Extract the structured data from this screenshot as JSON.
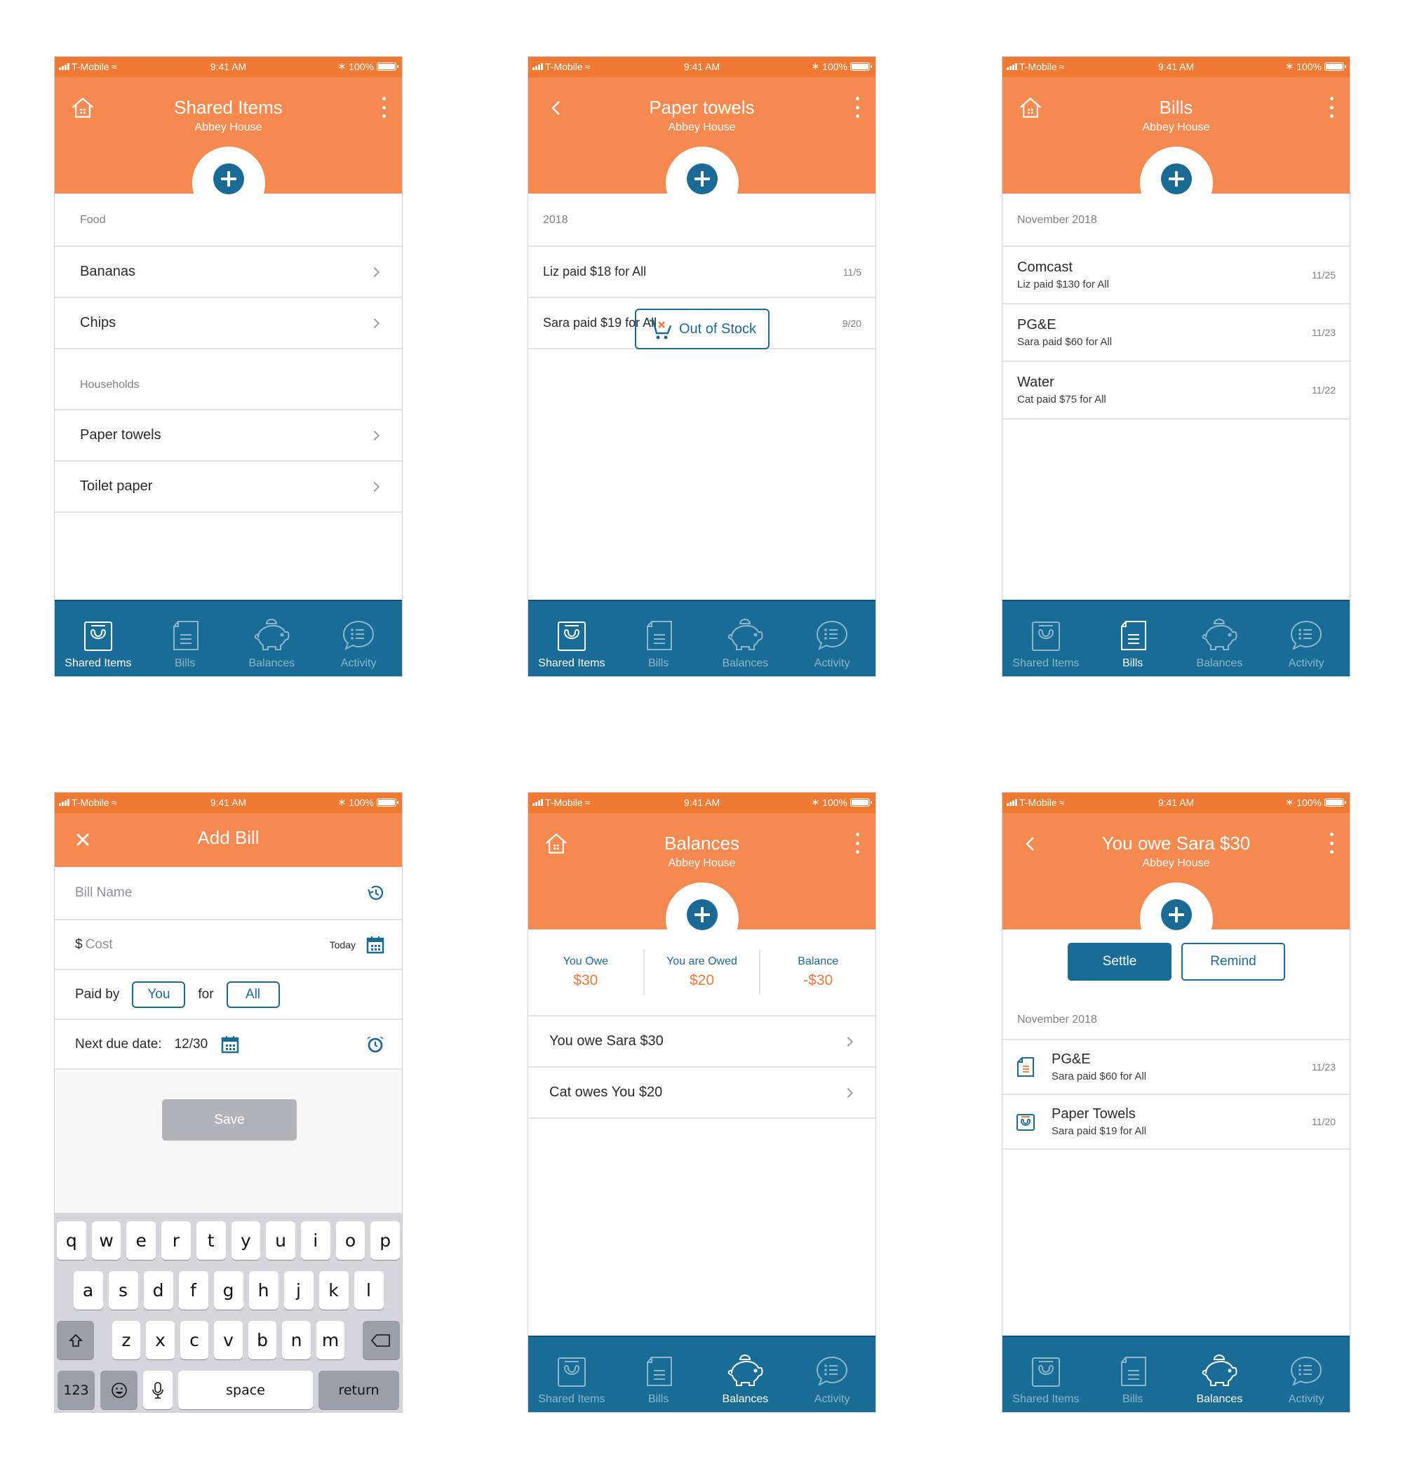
{
  "status_bar": {
    "carrier": "T-Mobile",
    "time": "9:41 AM",
    "battery": "100%"
  },
  "colors": {
    "orange": "#F5894F",
    "status_orange": "#F07A33",
    "blue": "#186C96",
    "amount_orange": "#F07A33"
  },
  "tabs": [
    {
      "label": "Shared Items",
      "icon": "shopping-bag-icon"
    },
    {
      "label": "Bills",
      "icon": "document-icon"
    },
    {
      "label": "Balances",
      "icon": "piggy-bank-icon"
    },
    {
      "label": "Activity",
      "icon": "chat-list-icon"
    }
  ],
  "screens": {
    "shared_items": {
      "title": "Shared Items",
      "subtitle": "Abbey House",
      "sections": [
        {
          "header": "Food",
          "items": [
            "Bananas",
            "Chips"
          ]
        },
        {
          "header": "Households",
          "items": [
            "Paper towels",
            "Toilet paper"
          ]
        }
      ],
      "active_tab": "Shared Items"
    },
    "paper_towels": {
      "title": "Paper towels",
      "subtitle": "Abbey House",
      "section_header": "2018",
      "entries": [
        {
          "text": "Liz paid $18 for All",
          "date": "11/5"
        },
        {
          "text": "Sara paid $19 for All",
          "date": "9/20"
        }
      ],
      "out_of_stock_label": "Out of Stock",
      "active_tab": "Shared Items"
    },
    "bills": {
      "title": "Bills",
      "subtitle": "Abbey House",
      "section_header": "November 2018",
      "entries": [
        {
          "name": "Comcast",
          "detail": "Liz paid $130 for All",
          "date": "11/25"
        },
        {
          "name": "PG&E",
          "detail": "Sara paid $60 for All",
          "date": "11/23"
        },
        {
          "name": "Water",
          "detail": "Cat paid $75 for All",
          "date": "11/22"
        }
      ],
      "active_tab": "Bills"
    },
    "add_bill": {
      "title": "Add Bill",
      "bill_name_placeholder": "Bill Name",
      "currency_symbol": "$",
      "cost_placeholder": "Cost",
      "date_label": "Today",
      "paid_by_label": "Paid by",
      "paid_by_value": "You",
      "for_label": "for",
      "for_value": "All",
      "next_due_label": "Next due date:",
      "next_due_value": "12/30",
      "save_label": "Save",
      "keyboard": {
        "row1": [
          "q",
          "w",
          "e",
          "r",
          "t",
          "y",
          "u",
          "i",
          "o",
          "p"
        ],
        "row2": [
          "a",
          "s",
          "d",
          "f",
          "g",
          "h",
          "j",
          "k",
          "l"
        ],
        "row3": [
          "z",
          "x",
          "c",
          "v",
          "b",
          "n",
          "m"
        ],
        "numbers_label": "123",
        "space_label": "space",
        "return_label": "return"
      }
    },
    "balances": {
      "title": "Balances",
      "subtitle": "Abbey House",
      "totals": [
        {
          "label": "You Owe",
          "value": "$30"
        },
        {
          "label": "You are Owed",
          "value": "$20"
        },
        {
          "label": "Balance",
          "value": "-$30"
        }
      ],
      "entries": [
        "You owe Sara $30",
        "Cat owes You $20"
      ],
      "active_tab": "Balances"
    },
    "owe_sara": {
      "title": "You owe Sara $30",
      "subtitle": "Abbey House",
      "settle_label": "Settle",
      "remind_label": "Remind",
      "section_header": "November 2018",
      "entries": [
        {
          "icon": "bill-document-icon",
          "name": "PG&E",
          "detail": "Sara paid $60 for All",
          "date": "11/23"
        },
        {
          "icon": "shared-item-bag-icon",
          "name": "Paper Towels",
          "detail": "Sara paid $19 for All",
          "date": "11/20"
        }
      ],
      "active_tab": "Balances"
    }
  }
}
